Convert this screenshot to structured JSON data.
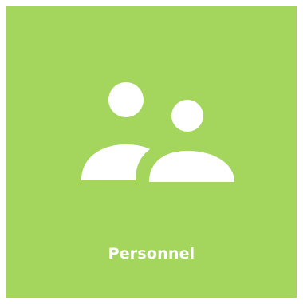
{
  "tile": {
    "label": "Personnel",
    "background_color": "#a4d65e",
    "icon": "people-icon",
    "icon_color": "#ffffff"
  }
}
